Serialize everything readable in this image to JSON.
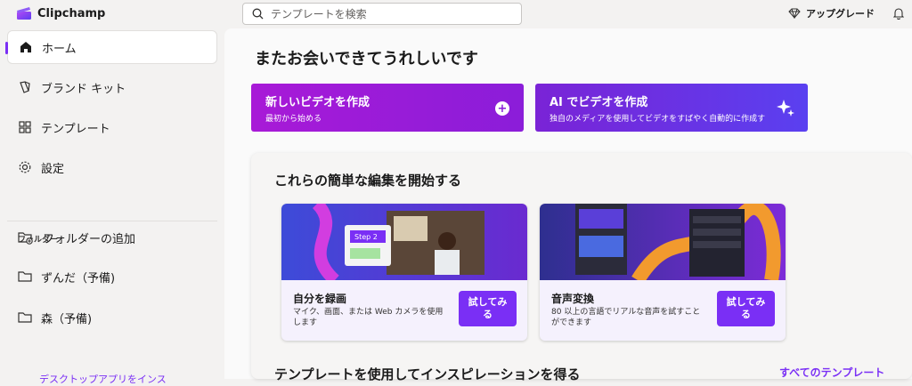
{
  "app": {
    "name": "Clipchamp"
  },
  "search": {
    "placeholder": "テンプレートを検索"
  },
  "header": {
    "upgrade_label": "アップグレード"
  },
  "sidebar": {
    "items": [
      {
        "label": "ホーム",
        "icon": "home-icon",
        "active": true
      },
      {
        "label": "ブランド キット",
        "icon": "brand-kit-icon"
      },
      {
        "label": "テンプレート",
        "icon": "template-icon"
      },
      {
        "label": "設定",
        "icon": "gear-icon"
      }
    ],
    "folders_label": "フォルダー",
    "folders": [
      {
        "label": "フォルダーの追加",
        "icon": "folder-add-icon"
      },
      {
        "label": "ずんだ（予備)",
        "icon": "folder-icon"
      },
      {
        "label": "森（予備)",
        "icon": "folder-icon"
      }
    ],
    "bottom_link": "デスクトップアプリをインス"
  },
  "main": {
    "greeting": "またお会いできてうれしいです",
    "cta_new": {
      "title": "新しいビデオを作成",
      "subtitle": "最初から始める"
    },
    "cta_ai": {
      "title": "AI でビデオを作成",
      "subtitle": "独自のメディアを使用してビデオをすばやく自動的に作成す"
    },
    "edits": {
      "title": "これらの簡単な編集を開始する",
      "cards": [
        {
          "title": "自分を録画",
          "desc": "マイク、画面、または Web カメラを使用します",
          "button": "試してみる",
          "thumb_label": "Step 2"
        },
        {
          "title": "音声変換",
          "desc": "80 以上の言語でリアルな音声を試すことができます",
          "button": "試してみる"
        }
      ]
    },
    "templates": {
      "title": "テンプレートを使用してインスピレーションを得る",
      "all_link": "すべてのテンプレート"
    }
  },
  "colors": {
    "accent": "#7a2ff5",
    "cta_new": "#a81ad7",
    "cta_ai": "#5a40f0"
  }
}
